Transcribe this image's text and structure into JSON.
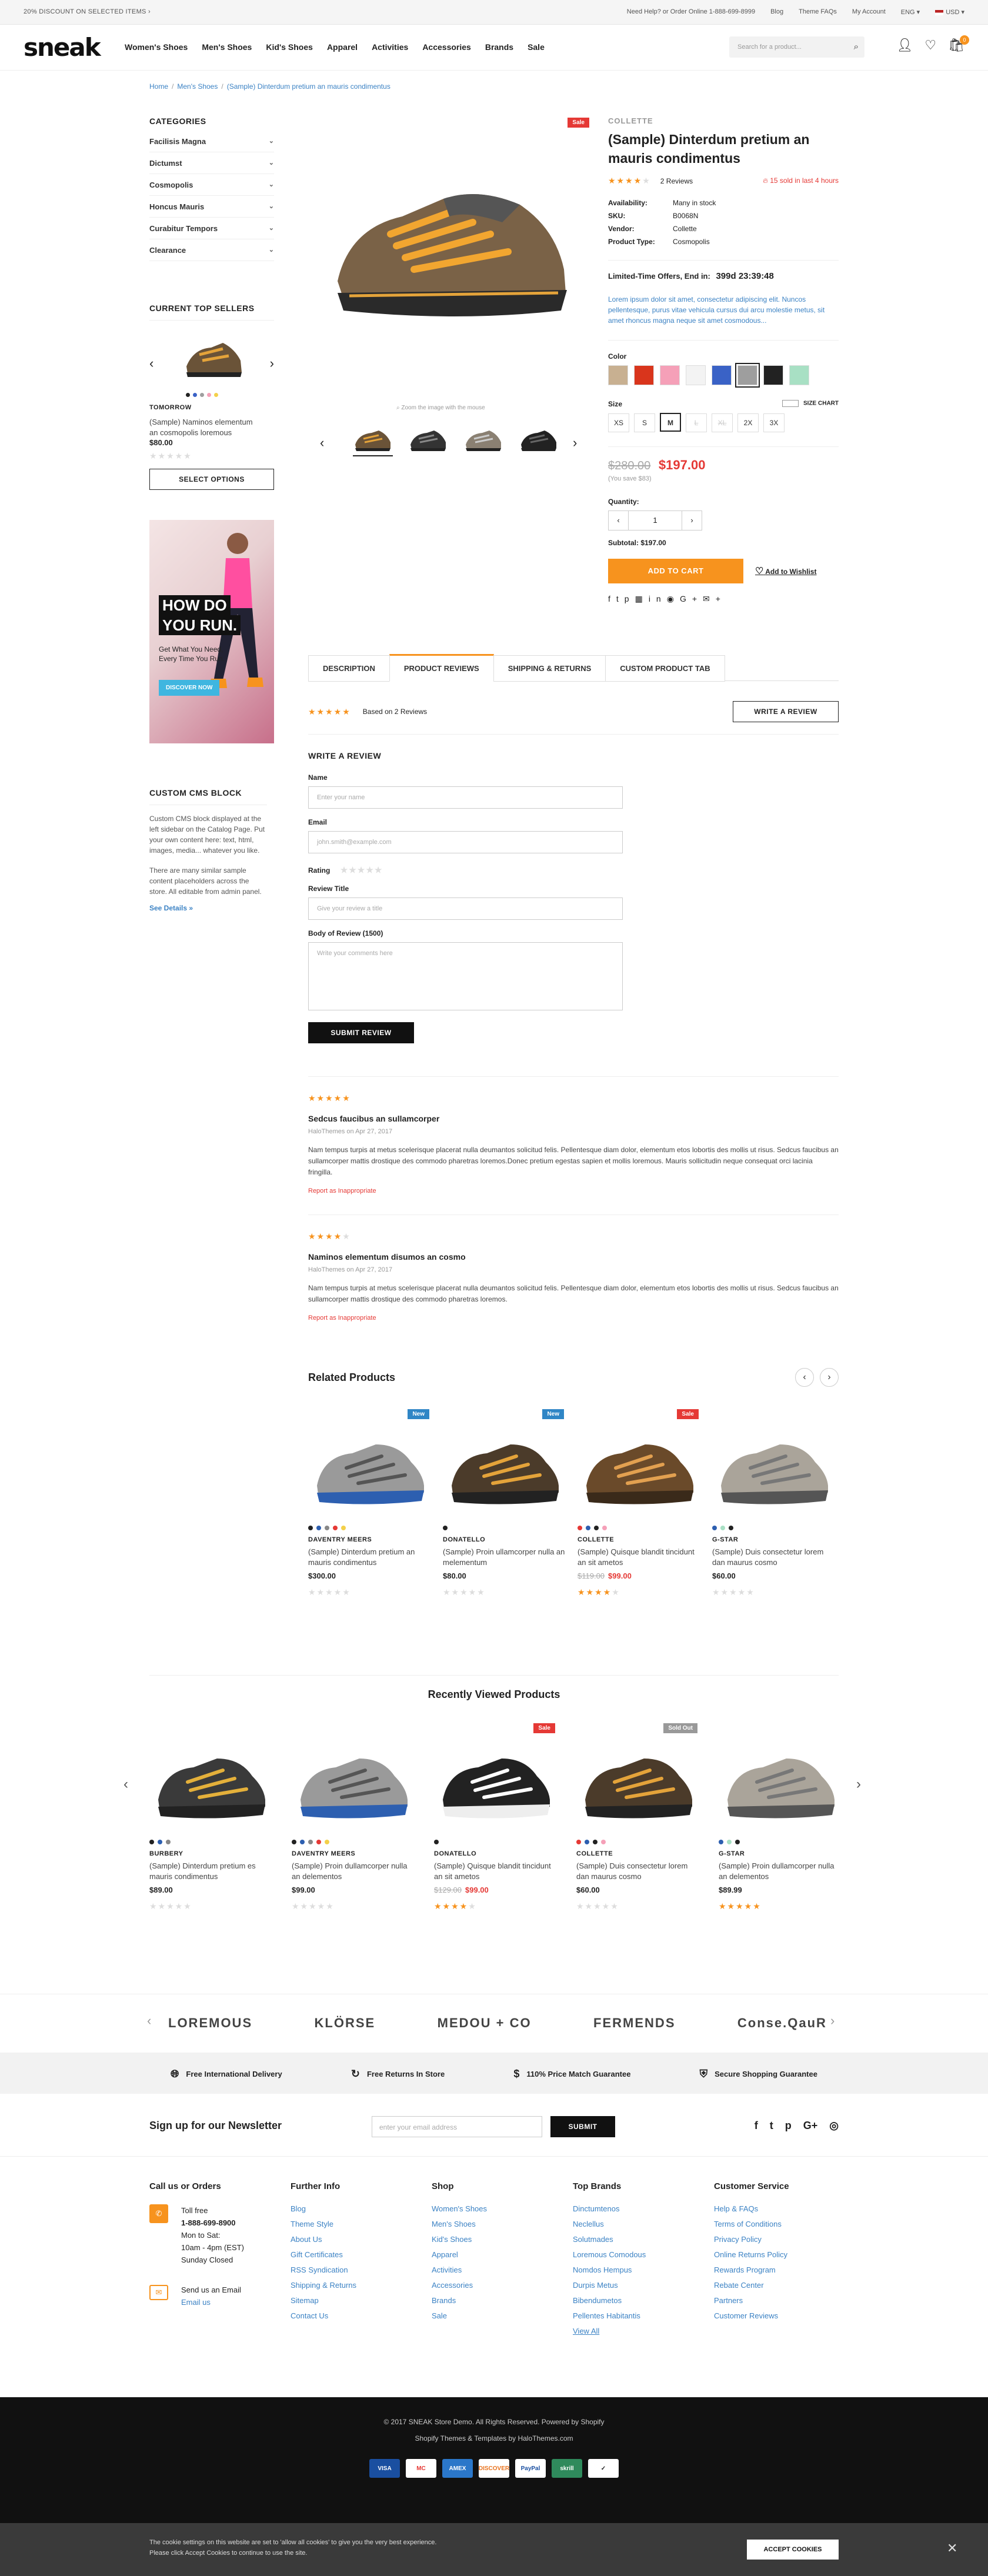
{
  "topbar": {
    "promo": "20% DISCOUNT ON SELECTED ITEMS ›",
    "help": "Need Help? or Order Online 1-888-699-8999",
    "blog": "Blog",
    "faqs": "Theme FAQs",
    "account": "My Account",
    "lang": "ENG",
    "currency": "USD"
  },
  "header": {
    "logo": "sneak",
    "search_placeholder": "Search for a product...",
    "cart_count": "0",
    "nav": [
      "Women's Shoes",
      "Men's Shoes",
      "Kid's Shoes",
      "Apparel",
      "Activities",
      "Accessories",
      "Brands",
      "Sale"
    ]
  },
  "breadcrumb": [
    "Home",
    "Men's Shoes",
    "(Sample) Dinterdum pretium an mauris condimentus"
  ],
  "sidebar": {
    "categories_title": "CATEGORIES",
    "categories": [
      "Facilisis Magna",
      "Dictumst",
      "Cosmopolis",
      "Honcus Mauris",
      "Curabitur Tempors",
      "Clearance"
    ],
    "top_sellers_title": "CURRENT TOP SELLERS",
    "seller_brand": "TOMORROW",
    "seller_name": "(Sample) Naminos elementum an cosmopolis loremous",
    "seller_price": "$80.00",
    "select_options": "SELECT OPTIONS",
    "banner": {
      "h1": "HOW DO",
      "h2": "YOU RUN.",
      "sub": "Get What You Need, Every Time You Run.",
      "cta": "DISCOVER NOW"
    },
    "cms_title": "CUSTOM CMS BLOCK",
    "cms_p1": "Custom CMS block displayed at the left sidebar on the Catalog Page. Put your own content here: text, html, images, media... whatever you like.",
    "cms_p2": "There are many similar sample content placeholders across the store. All editable from admin panel.",
    "cms_link": "See Details »"
  },
  "product": {
    "sale_badge": "Sale",
    "vendor_top": "COLLETTE",
    "title": "(Sample) Dinterdum pretium an mauris condimentus",
    "reviews": "2 Reviews",
    "sold": "15 sold in last 4 hours",
    "avail_label": "Availability:",
    "avail": "Many in stock",
    "sku_label": "SKU:",
    "sku": "B0068N",
    "vendor_label": "Vendor:",
    "vendor": "Collette",
    "type_label": "Product Type:",
    "type": "Cosmopolis",
    "countdown_label": "Limited-Time Offers, End in:",
    "countdown": "399d 23:39:48",
    "desc": "Lorem ipsum dolor sit amet, consectetur adipiscing elit. Nuncos pellentesque, purus vitae vehicula cursus dui arcu molestie metus, sit amet rhoncus magna neque sit amet cosmodous...",
    "zoom_hint": "Zoom the image with the mouse",
    "color_label": "Color",
    "size_label": "Size",
    "size_chart": "SIZE CHART",
    "sizes": [
      "XS",
      "S",
      "M",
      "L",
      "XL",
      "2X",
      "3X"
    ],
    "old_price": "$280.00",
    "price": "$197.00",
    "save": "(You save $83)",
    "qty_label": "Quantity:",
    "qty": "1",
    "subtotal": "Subtotal: $197.00",
    "add_to_cart": "ADD TO CART",
    "wishlist": "Add to Wishlist",
    "swatch_colors": [
      "#c8b091",
      "#d9351c",
      "#f5a0b8",
      "#f3f3f3",
      "#3a62c6",
      "#9e9e9e",
      "#222222",
      "#a8e0c4"
    ]
  },
  "tabs": [
    "DESCRIPTION",
    "PRODUCT REVIEWS",
    "SHIPPING & RETURNS",
    "CUSTOM PRODUCT TAB"
  ],
  "reviews": {
    "summary": "Based on 2 Reviews",
    "write_btn": "WRITE A REVIEW",
    "form_title": "WRITE A REVIEW",
    "name_label": "Name",
    "name_ph": "Enter your name",
    "email_label": "Email",
    "email_ph": "john.smith@example.com",
    "rating_label": "Rating",
    "title_label": "Review Title",
    "title_ph": "Give your review a title",
    "body_label": "Body of Review (1500)",
    "body_ph": "Write your comments here",
    "submit": "SUBMIT REVIEW",
    "items": [
      {
        "title": "Sedcus faucibus an sullamcorper",
        "meta": "HaloThemes on Apr 27, 2017",
        "body": "Nam tempus turpis at metus scelerisque placerat nulla deumantos solicitud felis. Pellentesque diam dolor, elementum etos lobortis des mollis ut risus. Sedcus faucibus an sullamcorper mattis drostique des commodo pharetras loremos.Donec pretium egestas sapien et mollis loremous. Mauris sollicitudin neque consequat orci lacinia fringilla.",
        "report": "Report as Inappropriate"
      },
      {
        "title": "Naminos elementum disumos an cosmo",
        "meta": "HaloThemes on Apr 27, 2017",
        "body": "Nam tempus turpis at metus scelerisque placerat nulla deumantos solicitud felis. Pellentesque diam dolor, elementum etos lobortis des mollis ut risus. Sedcus faucibus an sullamcorper mattis drostique des commodo pharetras loremos.",
        "report": "Report as Inappropriate"
      }
    ]
  },
  "related": {
    "title": "Related Products",
    "items": [
      {
        "badge": "New",
        "brand": "DAVENTRY MEERS",
        "name": "(Sample) Dinterdum pretium an mauris condimentus",
        "price": "$300.00",
        "old": ""
      },
      {
        "badge": "New",
        "brand": "DONATELLO",
        "name": "(Sample) Proin ullamcorper nulla an melementum",
        "price": "$80.00",
        "old": ""
      },
      {
        "badge": "Sale",
        "brand": "COLLETTE",
        "name": "(Sample) Quisque blandit tincidunt an sit ametos",
        "price": "$99.00",
        "old": "$119.00"
      },
      {
        "badge": "",
        "brand": "G-STAR",
        "name": "(Sample) Duis consectetur lorem dan maurus cosmo",
        "price": "$60.00",
        "old": ""
      }
    ]
  },
  "recent": {
    "title": "Recently Viewed Products",
    "items": [
      {
        "badge": "",
        "brand": "BURBERY",
        "name": "(Sample) Dinterdum pretium es mauris condimentus",
        "price": "$89.00",
        "old": ""
      },
      {
        "badge": "",
        "brand": "DAVENTRY MEERS",
        "name": "(Sample) Proin dullamcorper nulla an delementos",
        "price": "$99.00",
        "old": ""
      },
      {
        "badge": "Sale",
        "brand": "DONATELLO",
        "name": "(Sample) Quisque blandit tincidunt an sit ametos",
        "price": "$99.00",
        "old": "$129.00"
      },
      {
        "badge": "Sold Out",
        "brand": "COLLETTE",
        "name": "(Sample) Duis consectetur lorem dan maurus cosmo",
        "price": "$60.00",
        "old": ""
      },
      {
        "badge": "",
        "brand": "G-STAR",
        "name": "(Sample) Proin dullamcorper nulla an delementos",
        "price": "$89.99",
        "old": ""
      }
    ]
  },
  "brands": [
    "LOREMOUS",
    "KLÖRSE",
    "MEDOU + CO",
    "FERMENDS",
    "Conse.QauR"
  ],
  "features": [
    "Free International Delivery",
    "Free Returns In Store",
    "110% Price Match Guarantee",
    "Secure Shopping Guarantee"
  ],
  "newsletter": {
    "title": "Sign up for our Newsletter",
    "placeholder": "enter your email address",
    "btn": "SUBMIT"
  },
  "footer": {
    "call_title": "Call us or Orders",
    "toll": "Toll free",
    "phone": "1-888-699-8900",
    "hours1": "Mon to Sat:",
    "hours2": "10am - 4pm (EST)",
    "hours3": "Sunday Closed",
    "email_label": "Send us an Email",
    "email_link": "Email us",
    "cols": [
      {
        "title": "Further Info",
        "links": [
          "Blog",
          "Theme Style",
          "About Us",
          "Gift Certificates",
          "RSS Syndication",
          "Shipping & Returns",
          "Sitemap",
          "Contact Us"
        ]
      },
      {
        "title": "Shop",
        "links": [
          "Women's Shoes",
          "Men's Shoes",
          "Kid's Shoes",
          "Apparel",
          "Activities",
          "Accessories",
          "Brands",
          "Sale"
        ]
      },
      {
        "title": "Top Brands",
        "links": [
          "Dinctumtenos",
          "Neclellus",
          "Solutmades",
          "Loremous Comodous",
          "Nomdos Hempus",
          "Durpis Metus",
          "Bibendumetos",
          "Pellentes Habitantis",
          "View All"
        ]
      },
      {
        "title": "Customer Service",
        "links": [
          "Help & FAQs",
          "Terms of Conditions",
          "Privacy Policy",
          "Online Returns Policy",
          "Rewards Program",
          "Rebate Center",
          "Partners",
          "Customer Reviews"
        ]
      }
    ]
  },
  "bottom": {
    "copy": "© 2017 SNEAK Store Demo. All Rights Reserved.  Powered by Shopify",
    "credit": "Shopify Themes & Templates by HaloThemes.com",
    "pays": [
      "VISA",
      "MC",
      "AMEX",
      "DISCOVER",
      "PayPal",
      "skrill",
      "✓"
    ]
  },
  "cookie": {
    "text1": "The cookie settings on this website are set to 'allow all cookies' to give you the very best experience.",
    "text2": "Please click Accept Cookies to continue to use the site.",
    "btn": "ACCEPT COOKIES"
  }
}
